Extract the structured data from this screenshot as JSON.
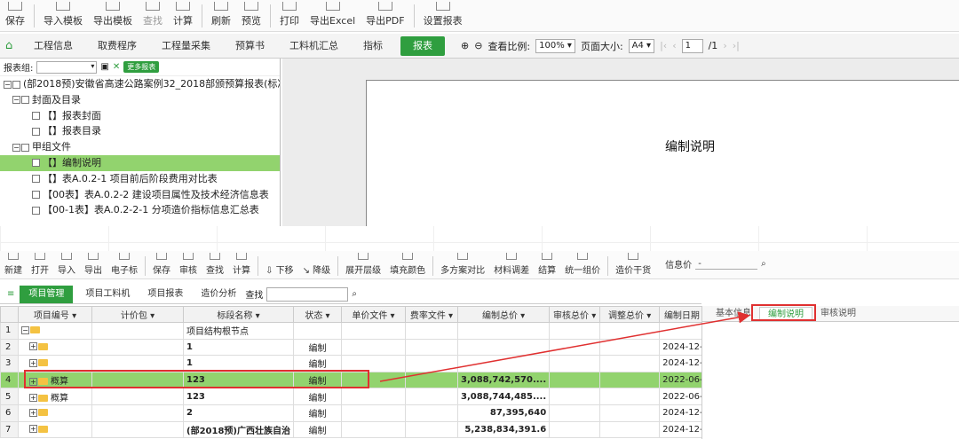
{
  "top_toolbar": [
    "保存",
    "导入模板",
    "导出模板",
    "查找",
    "计算",
    "刷新",
    "预览",
    "打印",
    "导出Excel",
    "导出PDF",
    "设置报表"
  ],
  "top_tabs": [
    "工程信息",
    "取费程序",
    "工程量采集",
    "预算书",
    "工料机汇总",
    "指标",
    "报表"
  ],
  "zoom": {
    "label": "查看比例:",
    "value": "100%",
    "page_size_label": "页面大小:",
    "page_size": "A4",
    "page_input": "1",
    "page_total": "/1"
  },
  "report_group": {
    "label": "报表组:",
    "more": "更多报表"
  },
  "tree": [
    {
      "text": "(部2018预)安徽省高速公路案例32_2018部颁预算报表(标准",
      "level": 0
    },
    {
      "text": "封面及目录",
      "level": 1
    },
    {
      "text": "【】报表封面",
      "level": 2
    },
    {
      "text": "【】报表目录",
      "level": 2
    },
    {
      "text": "甲组文件",
      "level": 1
    },
    {
      "text": "【】编制说明",
      "level": 2
    },
    {
      "text": "【】表A.0.2-1 项目前后阶段费用对比表",
      "level": 2
    },
    {
      "text": "【00表】表A.0.2-2 建设项目属性及技术经济信息表",
      "level": 2
    },
    {
      "text": "【00-1表】表A.0.2-2-1 分项造价指标信息汇总表",
      "level": 2
    }
  ],
  "paper_title": "编制说明",
  "bottom_toolbar": [
    "新建",
    "打开",
    "导入",
    "导出",
    "电子标",
    "保存",
    "审核",
    "查找",
    "计算",
    "下移",
    "降级",
    "展开层级",
    "填充颜色",
    "多方案对比",
    "材料调差",
    "结算",
    "统一组价",
    "造价干货"
  ],
  "price_info": "信息价",
  "bottom_tabs": [
    "项目管理",
    "项目工料机",
    "项目报表",
    "造价分析",
    "查找"
  ],
  "table": {
    "headers": [
      "项目编号",
      "计价包",
      "标段名称",
      "状态",
      "单价文件",
      "费率文件",
      "编制总价",
      "审核总价",
      "调整总价",
      "编制日期"
    ],
    "rows": [
      [
        "1",
        "",
        "",
        "项目结构根节点",
        "",
        "",
        "",
        "",
        "",
        "",
        ""
      ],
      [
        "2",
        "",
        "",
        "1",
        "编制",
        "",
        "",
        "",
        "",
        "",
        "2024-12-2"
      ],
      [
        "3",
        "",
        "",
        "1",
        "编制",
        "",
        "",
        "",
        "",
        "",
        "2024-12-2"
      ],
      [
        "4",
        "概算",
        "",
        "123",
        "编制",
        "",
        "",
        "3,088,742,570....",
        "",
        "",
        "2022-06-0"
      ],
      [
        "5",
        "概算",
        "",
        "123",
        "编制",
        "",
        "",
        "3,088,744,485....",
        "",
        "",
        "2022-06-0"
      ],
      [
        "6",
        "",
        "",
        "2",
        "编制",
        "",
        "",
        "87,395,640",
        "",
        "",
        "2024-12-0"
      ],
      [
        "7",
        "",
        "",
        "(部2018预)广西壮族自治",
        "编制",
        "",
        "",
        "5,238,834,391.6",
        "",
        "",
        "2024-12-0"
      ]
    ]
  },
  "right_tabs": [
    "基本信息",
    "编制说明",
    "审核说明"
  ],
  "colors": {
    "accent": "#2f9e3f",
    "highlight": "#92d36e",
    "annotation": "#e03030"
  }
}
